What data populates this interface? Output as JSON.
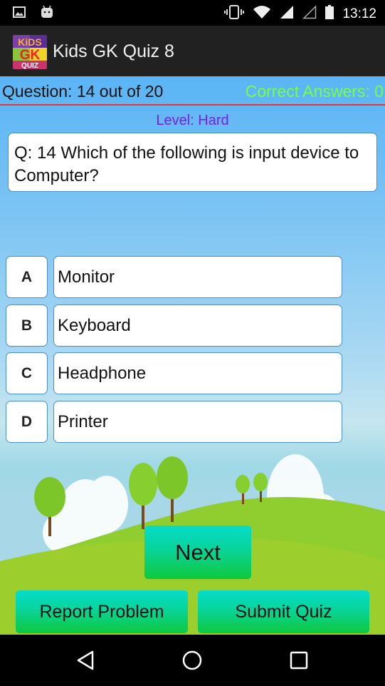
{
  "status_bar": {
    "time": "13:12",
    "left_icons": [
      "image-notification-icon",
      "android-notification-icon"
    ],
    "right_icons": [
      "vibrate-icon",
      "wifi-icon",
      "signal-icon",
      "signal-empty-icon",
      "battery-icon"
    ]
  },
  "app_bar": {
    "title": "Kids GK Quiz 8",
    "logo": {
      "line1": "KiDS",
      "line2": "GK",
      "line3": "QUIZ"
    }
  },
  "quiz": {
    "question_counter": "Question: 14 out of 20",
    "correct_answers": "Correct Answers: 0",
    "level": "Level: Hard",
    "question": "Q: 14  Which of the following is input device to Computer?",
    "options": [
      {
        "letter": "A",
        "text": "Monitor"
      },
      {
        "letter": "B",
        "text": "Keyboard"
      },
      {
        "letter": "C",
        "text": "Headphone"
      },
      {
        "letter": "D",
        "text": "Printer"
      }
    ]
  },
  "buttons": {
    "next": "Next",
    "report": "Report Problem",
    "submit": "Submit Quiz"
  },
  "colors": {
    "correct_answers": "#76ff4a",
    "level": "#7a1ee6",
    "divider": "#e53935",
    "button_top": "#06dccb",
    "button_bottom": "#0fc83c"
  },
  "nav_bar": {
    "icons": [
      "back-icon",
      "home-icon",
      "recents-icon"
    ]
  }
}
